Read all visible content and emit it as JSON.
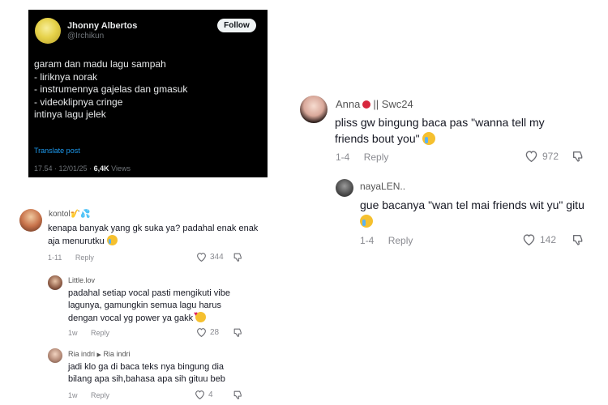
{
  "tweet": {
    "name": "Jhonny Albertos",
    "handle": "@Irchikun",
    "follow_label": "Follow",
    "lines": [
      "garam dan madu lagu sampah",
      "- liriknya norak",
      "- instrumennya gajelas dan gmasuk",
      "- videoklipnya cringe",
      "intinya lagu jelek"
    ],
    "translate_label": "Translate post",
    "time_date": "17.54 · 12/01/25 ·",
    "views_count": "6,4K",
    "views_label": "Views"
  },
  "left_thread": {
    "main": {
      "username": "kontol",
      "text": "kenapa banyak yang gk suka ya? padahal enak enak aja menurutku",
      "age": "1-11",
      "reply_label": "Reply",
      "likes": "344"
    },
    "replies": [
      {
        "username": "Little.lov",
        "text": "padahal setiap vocal pasti mengikuti vibe lagunya, gamungkin semua lagu harus dengan vocal yg power ya gakk",
        "age": "1w",
        "reply_label": "Reply",
        "likes": "28"
      },
      {
        "username": "Ria indri",
        "reply_to": "Ria indri",
        "text": "jadi klo ga di baca teks nya bingung dia bilang apa sih,bahasa apa sih gituu beb",
        "age": "1w",
        "reply_label": "Reply",
        "likes": "4"
      }
    ]
  },
  "right_thread": {
    "main": {
      "username": "Anna",
      "username_suffix": "|| Swc24",
      "text": "pliss gw bingung baca pas \"wanna tell my friends bout you\"",
      "age": "1-4",
      "reply_label": "Reply",
      "likes": "972"
    },
    "reply": {
      "username": "nayaLEN..",
      "text": "gue bacanya \"wan tel mai friends wit yu\" gitu",
      "age": "1-4",
      "reply_label": "Reply",
      "likes": "142"
    }
  },
  "icons": [
    "heart-icon",
    "dislike-icon",
    "crying-emoji-icon",
    "reply-arrow-icon",
    "apple-emoji-icon"
  ],
  "colors": {
    "tweet_bg": "#000000",
    "link_blue": "#1d9bf0",
    "text_muted": "#8a8b91"
  }
}
